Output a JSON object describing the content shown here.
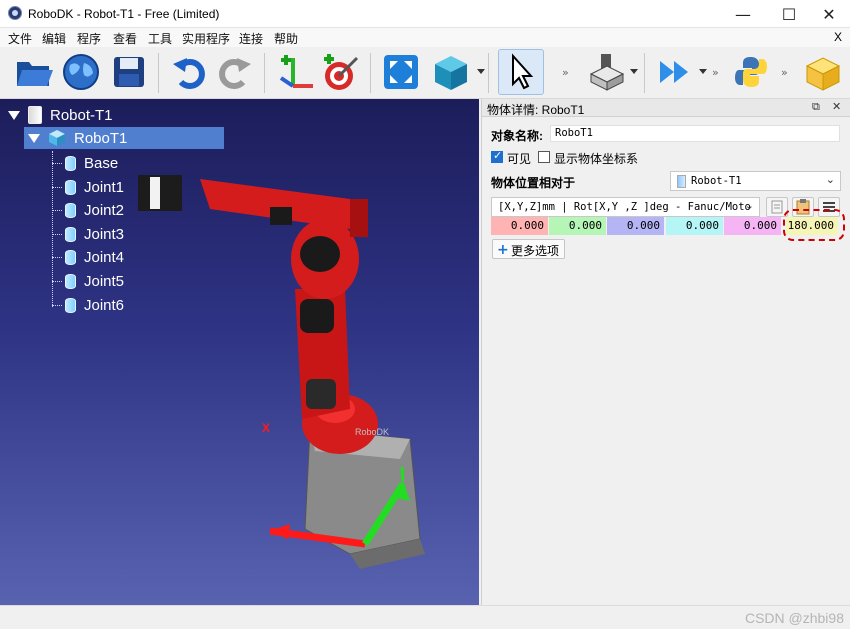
{
  "window": {
    "title": "RoboDK - Robot-T1 - Free (Limited)",
    "minimize": "—",
    "maximize": "☐",
    "close": "✕"
  },
  "menubar": {
    "items": [
      "文件",
      "编辑",
      "程序",
      "查看",
      "工具",
      "实用程序",
      "连接",
      "帮助"
    ],
    "close": "X"
  },
  "toolbar": {
    "more": "»",
    "buttons": [
      "open-folder-icon",
      "globe-icon",
      "save-icon",
      "undo-icon",
      "redo-icon",
      "add-frame-icon",
      "add-target-icon",
      "fit-all-icon",
      "view-cube-icon",
      "select-pointer-icon",
      "add-tool-icon",
      "run-program-icon",
      "python-icon",
      "package-icon"
    ]
  },
  "tree": {
    "root": "Robot-T1",
    "robot": "RoboT1",
    "children": [
      "Base",
      "Joint1",
      "Joint2",
      "Joint3",
      "Joint4",
      "Joint5",
      "Joint6"
    ]
  },
  "viewport": {
    "axis_x": "X",
    "robot_label": "RoboDK"
  },
  "panel": {
    "title": "物体详情: RoboT1",
    "name_label": "对象名称:",
    "name_value": "RoboT1",
    "visible_label": "可见",
    "visible_checked": true,
    "show_frame_label": "显示物体坐标系",
    "show_frame_checked": false,
    "relative_label": "物体位置相对于",
    "relative_value": "Robot-T1",
    "format_value": "[X,Y,Z]mm | Rot[X,Y ,Z  ]deg - Fanuc/Moto",
    "pose_values": [
      "0.000",
      "0.000",
      "0.000",
      "0.000",
      "0.000",
      "180.000"
    ],
    "pose_colors": [
      "#ffb3b3",
      "#b5f5b5",
      "#b5b5f5",
      "#b5f5f5",
      "#f5b5f5",
      "#f5f5b5"
    ],
    "more_options": "更多选项"
  },
  "statusbar": {
    "watermark": "CSDN @zhbi98"
  }
}
